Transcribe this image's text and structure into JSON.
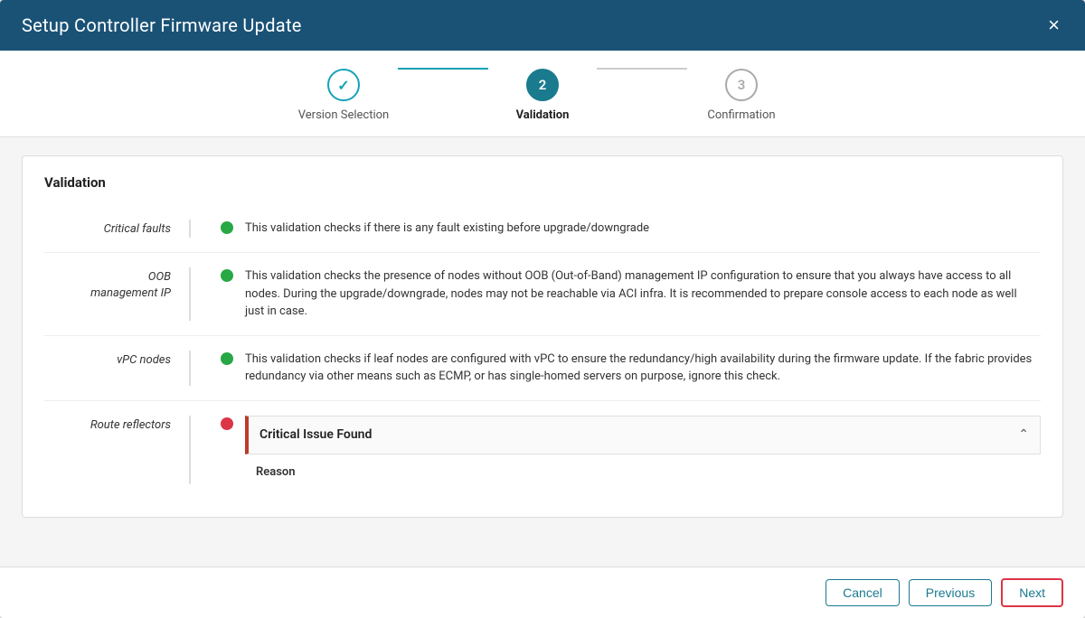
{
  "header": {
    "title": "Setup Controller Firmware Update",
    "close_label": "×"
  },
  "stepper": {
    "steps": [
      {
        "id": "step-1",
        "number": "✓",
        "label": "Version Selection",
        "state": "completed"
      },
      {
        "id": "step-2",
        "number": "2",
        "label": "Validation",
        "state": "active"
      },
      {
        "id": "step-3",
        "number": "3",
        "label": "Confirmation",
        "state": "inactive"
      }
    ],
    "lines": [
      {
        "state": "active"
      },
      {
        "state": "inactive"
      }
    ]
  },
  "validation": {
    "panel_title": "Validation",
    "rows": [
      {
        "label": "Critical faults",
        "indicator": "green",
        "description": "This validation checks if there is any fault existing before upgrade/downgrade"
      },
      {
        "label": "OOB\nmanagement IP",
        "indicator": "green",
        "description": "This validation checks the presence of nodes without OOB (Out-of-Band) management IP configuration to ensure that you always have access to all nodes. During the upgrade/downgrade, nodes may not be reachable via ACI infra. It is recommended to prepare console access to each node as well just in case."
      },
      {
        "label": "vPC nodes",
        "indicator": "green",
        "description": "This validation checks if leaf nodes are configured with vPC to ensure the redundancy/high availability during the firmware update. If the fabric provides redundancy via other means such as ECMP, or has single-homed servers on purpose, ignore this check."
      },
      {
        "label": "Route reflectors",
        "indicator": "red",
        "description": null,
        "critical": true,
        "critical_issue_title": "Critical Issue Found",
        "critical_reason_label": "Reason"
      }
    ]
  },
  "footer": {
    "cancel_label": "Cancel",
    "previous_label": "Previous",
    "next_label": "Next"
  }
}
